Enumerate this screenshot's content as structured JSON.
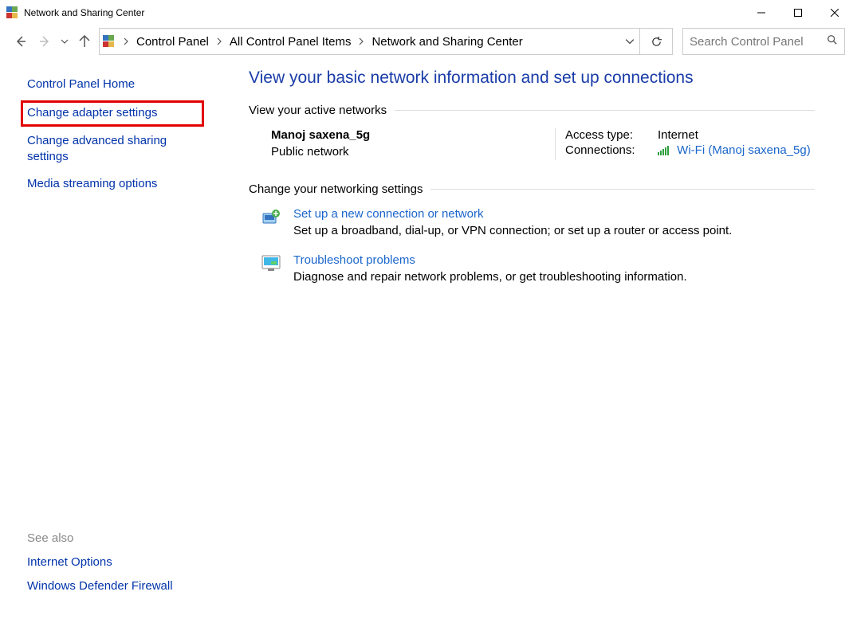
{
  "window": {
    "title": "Network and Sharing Center"
  },
  "breadcrumb": {
    "items": [
      "Control Panel",
      "All Control Panel Items",
      "Network and Sharing Center"
    ]
  },
  "search": {
    "placeholder": "Search Control Panel"
  },
  "sidebar": {
    "items": [
      "Control Panel Home",
      "Change adapter settings",
      "Change advanced sharing settings",
      "Media streaming options"
    ]
  },
  "seealso": {
    "header": "See also",
    "items": [
      "Internet Options",
      "Windows Defender Firewall"
    ]
  },
  "main": {
    "heading": "View your basic network information and set up connections",
    "active_header": "View your active networks",
    "network": {
      "name": "Manoj saxena_5g",
      "type": "Public network",
      "access_label": "Access type:",
      "access_value": "Internet",
      "conn_label": "Connections:",
      "conn_value": "Wi-Fi (Manoj saxena_5g)"
    },
    "change_header": "Change your networking settings",
    "tasks": [
      {
        "title": "Set up a new connection or network",
        "desc": "Set up a broadband, dial-up, or VPN connection; or set up a router or access point."
      },
      {
        "title": "Troubleshoot problems",
        "desc": "Diagnose and repair network problems, or get troubleshooting information."
      }
    ]
  }
}
